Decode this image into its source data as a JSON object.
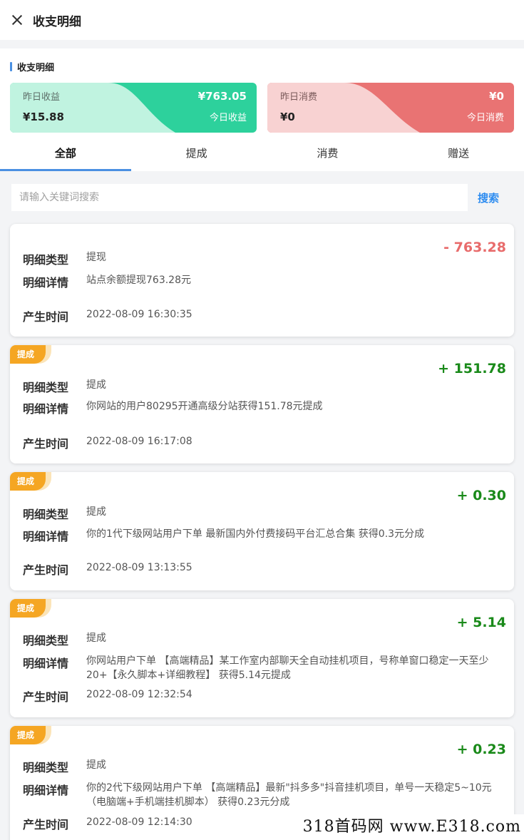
{
  "topbar": {
    "title": "收支明细"
  },
  "summary": {
    "heading": "收支明细",
    "income": {
      "label": "昨日收益",
      "yesterday": "¥15.88",
      "today": "¥763.05",
      "today_label": "今日收益"
    },
    "expense": {
      "label": "昨日消费",
      "yesterday": "¥0",
      "today": "¥0",
      "today_label": "今日消费"
    }
  },
  "tabs": [
    "全部",
    "提成",
    "消费",
    "赠送"
  ],
  "search": {
    "placeholder": "请输入关键词搜索",
    "button": "搜索"
  },
  "field_labels": {
    "type": "明细类型",
    "detail": "明细详情",
    "time": "产生时间"
  },
  "records": [
    {
      "badge": "",
      "amount": "- 763.28",
      "type": "提现",
      "detail": "站点余额提现763.28元",
      "time": "2022-08-09 16:30:35"
    },
    {
      "badge": "提成",
      "amount": "+ 151.78",
      "type": "提成",
      "detail": "你网站的用户80295开通高级分站获得151.78元提成",
      "time": "2022-08-09 16:17:08"
    },
    {
      "badge": "提成",
      "amount": "+ 0.30",
      "type": "提成",
      "detail": "你的1代下级网站用户下单 最新国内外付费接码平台汇总合集 获得0.3元分成",
      "time": "2022-08-09 13:13:55"
    },
    {
      "badge": "提成",
      "amount": "+ 5.14",
      "type": "提成",
      "detail": "你网站用户下单 【高端精品】某工作室内部聊天全自动挂机项目，号称单窗口稳定一天至少20+【永久脚本+详细教程】 获得5.14元提成",
      "time": "2022-08-09 12:32:54"
    },
    {
      "badge": "提成",
      "amount": "+ 0.23",
      "type": "提成",
      "detail": "你的2代下级网站用户下单 【高端精品】最新\"抖多多\"抖音挂机项目，单号一天稳定5~10元（电脑端+手机端挂机脚本） 获得0.23元分成",
      "time": "2022-08-09 12:14:30"
    }
  ],
  "watermark": "318首码网 www.E318.com"
}
